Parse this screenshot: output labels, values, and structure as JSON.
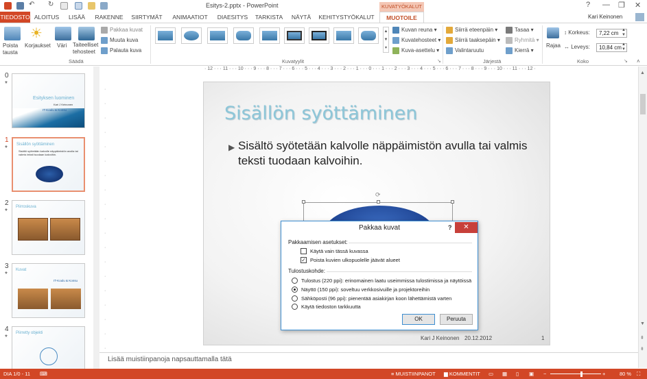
{
  "window": {
    "title": "Esitys-2.pptx - PowerPoint",
    "user": "Kari Keinonen",
    "help": "?",
    "minimize": "—",
    "maximize": "❐",
    "close": "✕"
  },
  "context_tab_group": "KUVATYÖKALUT",
  "tabs": [
    "TIEDOSTO",
    "ALOITUS",
    "LISÄÄ",
    "RAKENNE",
    "SIIRTYMÄT",
    "ANIMAATIOT",
    "DIAESITYS",
    "TARKISTA",
    "NÄYTÄ",
    "KEHITYSTYÖKALUT",
    "MUOTOILE"
  ],
  "ribbon": {
    "saada": {
      "poista_tausta": "Poista tausta",
      "korjaukset": "Korjaukset",
      "vari": "Väri",
      "taiteelliset": "Taiteelliset tehosteet",
      "pakkaa_kuvat": "Pakkaa kuvat",
      "muuta_kuva": "Muuta kuva",
      "palauta_kuva": "Palauta kuva",
      "label": "Säädä"
    },
    "kuvatyylit": {
      "label": "Kuvatyylit",
      "kuvan_reuna": "Kuvan reuna",
      "kuvatehosteet": "Kuvatehosteet",
      "kuva_asettelu": "Kuva-asettelu"
    },
    "jarjesta": {
      "label": "Järjestä",
      "siirra_eteen": "Siirrä eteenpäin",
      "siirra_taakse": "Siirrä taaksepäin",
      "valintaruutu": "Valintaruutu",
      "tasaa": "Tasaa",
      "ryhmita": "Ryhmitä",
      "kierra": "Kierrä"
    },
    "koko": {
      "label": "Koko",
      "rajaa": "Rajaa",
      "korkeus_label": "Korkeus:",
      "korkeus": "7,22 cm",
      "leveys_label": "Leveys:",
      "leveys": "10,84 cm"
    }
  },
  "ruler_h": "· 12 · · · 11 · · · 10 · · · 9 · · · 8 · · · 7 · · · 6 · · · 5 · · · 4 · · · 3 · · · 2 · · · 1 · · · 0 · · · 1 · · · 2 · · · 3 · · · 4 · · · 5 · · · 6 · · · 7 · · · 8 · · · 9 · · · 10 · · · 11 · · · 12 ·",
  "slides": [
    {
      "num": "0",
      "star": "*",
      "title": "Esityksen luominen",
      "sub": "Kari J Keinonen",
      "logo": "IT-Koulu & Konsu"
    },
    {
      "num": "1",
      "star": "*",
      "title": "Sisällön syöttäminen",
      "text": "Sisältö syötetään kalvolle näppäimistön avulla tai valmis teksti tuodaan kalvoihin."
    },
    {
      "num": "2",
      "star": "*",
      "title": "Piirroskuva"
    },
    {
      "num": "3",
      "star": "*",
      "title": "Kuvat",
      "logo": "IT-Koulu & Konsu"
    },
    {
      "num": "4",
      "star": "*",
      "title": "Piirretty objekti"
    }
  ],
  "slide": {
    "title": "Sisällön syöttäminen",
    "bullet_marker": "▶",
    "bullet": "Sisältö syötetään kalvolle näppäimistön avulla tai valmis teksti tuodaan kalvoihin.",
    "footer_name": "Kari J Keinonen",
    "footer_date": "20.12.2012",
    "footer_num": "1"
  },
  "dialog": {
    "title": "Pakkaa kuvat",
    "help": "?",
    "close": "✕",
    "section1": "Pakkaamisen asetukset:",
    "opt1": {
      "label": "Käytä vain tässä kuvassa",
      "checked": false
    },
    "opt2": {
      "label": "Poista kuvien ulkopuolelle jäävät alueet",
      "checked": true
    },
    "section2": "Tulostuskohde:",
    "radios": [
      {
        "label": "Tulostus (220 ppi): erinomainen laatu useimmissa tulostimissa ja näytöissä",
        "selected": false
      },
      {
        "label": "Näyttö (150 ppi): soveltuu verkkosivuille ja projektoreihin",
        "selected": true
      },
      {
        "label": "Sähköposti (96 ppi): pienentää asiakirjan koon lähettämistä varten",
        "selected": false
      },
      {
        "label": "Käytä tiedoston tarkkuutta",
        "selected": false
      }
    ],
    "ok": "OK",
    "cancel": "Peruuta"
  },
  "notes": "Lisää muistiinpanoja napsauttamalla tätä",
  "status": {
    "slide": "DIA 1/0 - 11",
    "notes": "MUISTIINPANOT",
    "comments": "KOMMENTIT",
    "zoom": "80 %"
  },
  "colors": {
    "accent": "#d24726",
    "title": "#8dc6d8"
  }
}
